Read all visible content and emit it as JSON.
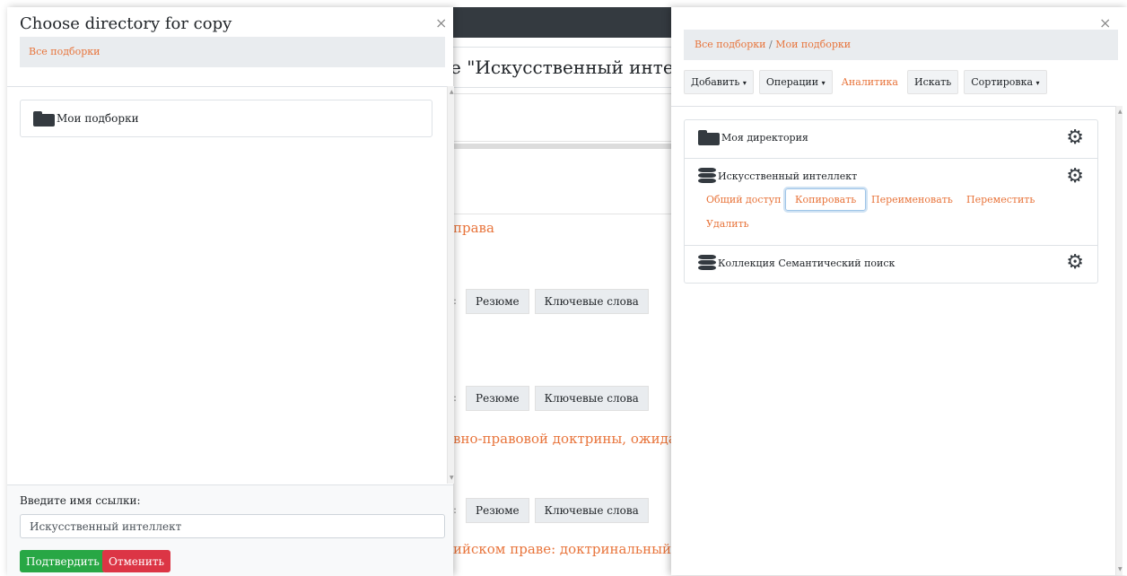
{
  "background": {
    "title_fragment": "е \"Искусственный интелл",
    "links": [
      "права",
      "вно-правовой доктрины, ожидающ",
      "ийском праве: доктринальный ана"
    ],
    "card_buttons": {
      "colon": ":",
      "summary": "Резюме",
      "keywords": "Ключевые слова"
    }
  },
  "left_panel": {
    "title": "Choose directory for copy",
    "close": "×",
    "breadcrumb": "Все подборки",
    "directories": [
      {
        "name": "Мои подборки"
      }
    ],
    "link_label": "Введите имя ссылки:",
    "link_value": "Искусственный интеллект",
    "confirm": "Подтвердить",
    "cancel": "Отменить"
  },
  "right_panel": {
    "close": "×",
    "breadcrumb": {
      "root": "Все подборки",
      "sep": "/",
      "current": "Мои подборки"
    },
    "toolbar": {
      "add": "Добавить",
      "operations": "Операции",
      "analytics": "Аналитика",
      "search": "Искать",
      "sort": "Сортировка",
      "caret": "▾"
    },
    "items": [
      {
        "name": "Моя директория",
        "type": "folder"
      },
      {
        "name": "Искусственный интеллект",
        "type": "collection"
      },
      {
        "name": "Коллекция Семантический поиск",
        "type": "collection"
      }
    ],
    "actions": {
      "share": "Общий доступ",
      "copy": "Копировать",
      "rename": "Переименовать",
      "move": "Переместить",
      "delete": "Удалить"
    }
  },
  "icons": {
    "folder": "folder-icon",
    "database": "database-icon",
    "gear": "gear-icon",
    "close": "close-icon"
  },
  "colors": {
    "link": "#e8743b",
    "confirm": "#28a745",
    "cancel": "#dc3545",
    "topbar": "#343a40"
  }
}
